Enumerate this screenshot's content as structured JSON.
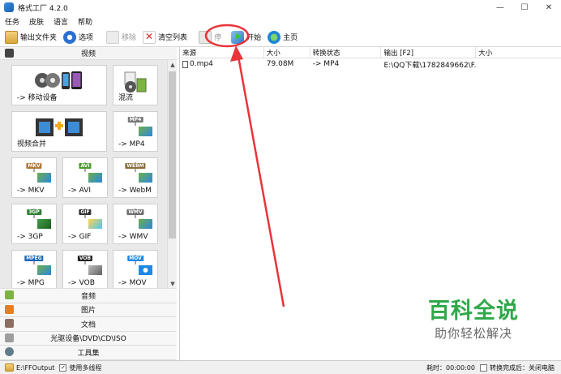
{
  "window": {
    "title": "格式工厂 4.2.0",
    "minimize": "—",
    "maximize": "☐",
    "close": "✕"
  },
  "menu": [
    "任务",
    "皮肤",
    "语言",
    "帮助"
  ],
  "toolbar": {
    "output_folder": "输出文件夹",
    "options": "选项",
    "remove": "移除",
    "clear_list": "清空列表",
    "stop": "停",
    "start": "开始",
    "home": "主页"
  },
  "left": {
    "video_header": "视频",
    "tiles": [
      {
        "label": "-> 移动设备",
        "icon": "mobile-device-icon"
      },
      {
        "label": "混流",
        "icon": "mux-icon"
      },
      {
        "label": "视频合并",
        "icon": "video-merge-icon"
      },
      {
        "label": "-> MP4",
        "tag": "MP4",
        "icon": "mp4-icon"
      },
      {
        "label": "-> MKV",
        "tag": "MKV",
        "icon": "mkv-icon"
      },
      {
        "label": "-> AVI",
        "tag": "AVI",
        "icon": "avi-icon"
      },
      {
        "label": "-> WebM",
        "tag": "WEBM",
        "icon": "webm-icon"
      },
      {
        "label": "-> 3GP",
        "tag": "3GP",
        "icon": "3gp-icon"
      },
      {
        "label": "-> GIF",
        "tag": "GIF",
        "icon": "gif-icon"
      },
      {
        "label": "-> WMV",
        "tag": "WMV",
        "icon": "wmv-icon"
      },
      {
        "label": "-> MPG",
        "tag": "MPEG",
        "icon": "mpg-icon"
      },
      {
        "label": "-> VOB",
        "tag": "VOB",
        "icon": "vob-icon"
      },
      {
        "label": "-> MOV",
        "tag": "MOV",
        "icon": "mov-icon"
      }
    ],
    "categories": [
      "音频",
      "图片",
      "文档",
      "光驱设备\\DVD\\CD\\ISO",
      "工具集"
    ]
  },
  "filelist": {
    "columns": [
      "来源",
      "大小",
      "转换状态",
      "输出 [F2]",
      "大小"
    ],
    "rows": [
      {
        "source": "0.mp4",
        "size": "79.08M",
        "status": "-> MP4",
        "output": "E:\\QQ下载\\1782849662\\F...",
        "out_size": ""
      }
    ]
  },
  "status": {
    "output_path": "E:\\FFOutput",
    "multithread": "使用多线程",
    "elapsed": "耗时：00:00:00",
    "after_convert": "转换完成后：关闭电脑"
  },
  "watermark": {
    "main": "百科全说",
    "sub": "助你轻松解决"
  },
  "colors": {
    "annotation": "#e8343a",
    "watermark": "#2fa84a"
  }
}
